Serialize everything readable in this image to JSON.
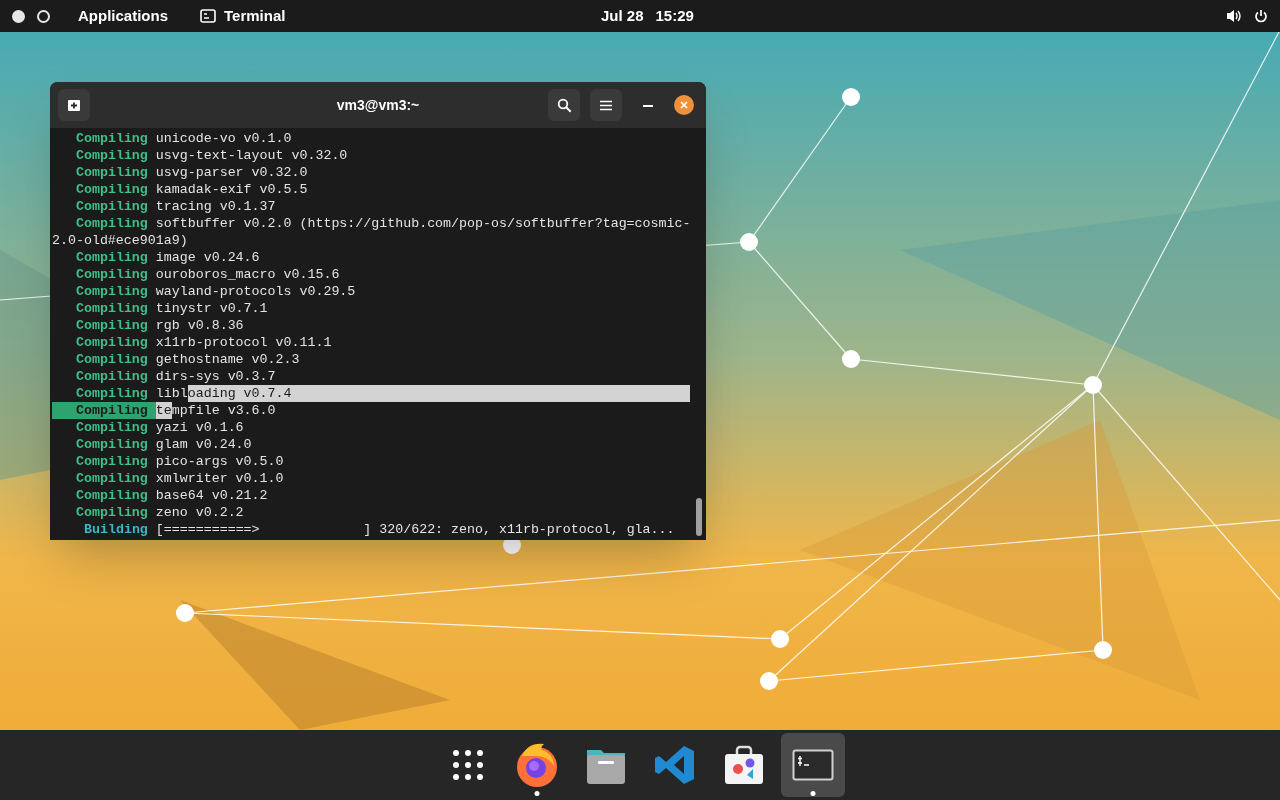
{
  "top_bar": {
    "workspaces": [
      {
        "selected": true
      },
      {
        "selected": false
      }
    ],
    "applications": "Applications",
    "active_app": "Terminal",
    "date": "Jul 28",
    "time": "15:29"
  },
  "window": {
    "title": "vm3@vm3:~",
    "lines": [
      {
        "kind": "compiling",
        "label": "Compiling",
        "label_selected": false,
        "parts": [
          {
            "text": "unicode-vo v0.1.0",
            "selected": false
          }
        ]
      },
      {
        "kind": "compiling",
        "label": "Compiling",
        "label_selected": false,
        "parts": [
          {
            "text": "usvg-text-layout v0.32.0",
            "selected": false
          }
        ]
      },
      {
        "kind": "compiling",
        "label": "Compiling",
        "label_selected": false,
        "parts": [
          {
            "text": "usvg-parser v0.32.0",
            "selected": false
          }
        ]
      },
      {
        "kind": "compiling",
        "label": "Compiling",
        "label_selected": false,
        "parts": [
          {
            "text": "kamadak-exif v0.5.5",
            "selected": false
          }
        ]
      },
      {
        "kind": "compiling",
        "label": "Compiling",
        "label_selected": false,
        "parts": [
          {
            "text": "tracing v0.1.37",
            "selected": false
          }
        ]
      },
      {
        "kind": "compiling",
        "label": "Compiling",
        "label_selected": false,
        "parts": [
          {
            "text": "softbuffer v0.2.0 (https://github.com/pop-os/softbuffer?tag=cosmic-",
            "selected": false
          }
        ]
      },
      {
        "kind": "continuation",
        "parts": [
          {
            "text": "2.0-old#ece901a9)",
            "selected": false
          }
        ]
      },
      {
        "kind": "compiling",
        "label": "Compiling",
        "label_selected": false,
        "parts": [
          {
            "text": "image v0.24.6",
            "selected": false
          }
        ]
      },
      {
        "kind": "compiling",
        "label": "Compiling",
        "label_selected": false,
        "parts": [
          {
            "text": "ouroboros_macro v0.15.6",
            "selected": false
          }
        ]
      },
      {
        "kind": "compiling",
        "label": "Compiling",
        "label_selected": false,
        "parts": [
          {
            "text": "wayland-protocols v0.29.5",
            "selected": false
          }
        ]
      },
      {
        "kind": "compiling",
        "label": "Compiling",
        "label_selected": false,
        "parts": [
          {
            "text": "tinystr v0.7.1",
            "selected": false
          }
        ]
      },
      {
        "kind": "compiling",
        "label": "Compiling",
        "label_selected": false,
        "parts": [
          {
            "text": "rgb v0.8.36",
            "selected": false
          }
        ]
      },
      {
        "kind": "compiling",
        "label": "Compiling",
        "label_selected": false,
        "parts": [
          {
            "text": "x11rb-protocol v0.11.1",
            "selected": false
          }
        ]
      },
      {
        "kind": "compiling",
        "label": "Compiling",
        "label_selected": false,
        "parts": [
          {
            "text": "gethostname v0.2.3",
            "selected": false
          }
        ]
      },
      {
        "kind": "compiling",
        "label": "Compiling",
        "label_selected": false,
        "parts": [
          {
            "text": "dirs-sys v0.3.7",
            "selected": false
          }
        ]
      },
      {
        "kind": "compiling",
        "label": "Compiling",
        "label_selected": false,
        "parts": [
          {
            "text": "libl",
            "selected": false
          },
          {
            "text": "oading v0.7.4",
            "selected": true
          }
        ],
        "selected_to_end": true
      },
      {
        "kind": "compiling",
        "label": "Compiling",
        "label_selected": true,
        "parts": [
          {
            "text": "te",
            "selected": true
          },
          {
            "text": "mpfile v3.6.0",
            "selected": false
          }
        ]
      },
      {
        "kind": "compiling",
        "label": "Compiling",
        "label_selected": false,
        "parts": [
          {
            "text": "yazi v0.1.6",
            "selected": false
          }
        ]
      },
      {
        "kind": "compiling",
        "label": "Compiling",
        "label_selected": false,
        "parts": [
          {
            "text": "glam v0.24.0",
            "selected": false
          }
        ]
      },
      {
        "kind": "compiling",
        "label": "Compiling",
        "label_selected": false,
        "parts": [
          {
            "text": "pico-args v0.5.0",
            "selected": false
          }
        ]
      },
      {
        "kind": "compiling",
        "label": "Compiling",
        "label_selected": false,
        "parts": [
          {
            "text": "xmlwriter v0.1.0",
            "selected": false
          }
        ]
      },
      {
        "kind": "compiling",
        "label": "Compiling",
        "label_selected": false,
        "parts": [
          {
            "text": "base64 v0.21.2",
            "selected": false
          }
        ]
      },
      {
        "kind": "compiling",
        "label": "Compiling",
        "label_selected": false,
        "parts": [
          {
            "text": "zeno v0.2.2",
            "selected": false
          }
        ]
      },
      {
        "kind": "building",
        "label": "Building",
        "label_selected": false,
        "parts": [
          {
            "text": "[===========>             ] 320/622: zeno, x11rb-protocol, gla...",
            "selected": false
          }
        ]
      }
    ]
  },
  "dock": [
    {
      "kind": "app-grid",
      "running": false,
      "selected": false
    },
    {
      "kind": "browser",
      "running": true,
      "selected": false
    },
    {
      "kind": "files",
      "running": false,
      "selected": false
    },
    {
      "kind": "code-editor",
      "running": false,
      "selected": false
    },
    {
      "kind": "store",
      "running": false,
      "selected": false
    },
    {
      "kind": "terminal",
      "running": true,
      "selected": true
    }
  ]
}
